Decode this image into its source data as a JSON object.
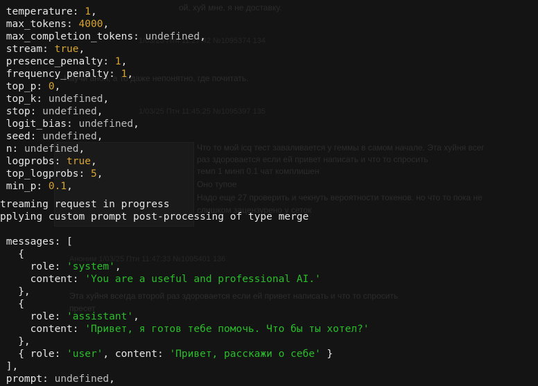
{
  "background_page": {
    "fragments": [
      "ой, хуй мне, я не доставку.",
      "Научи анон, а то даже непонятно, где почитать.",
      "Что то мой icq тест заваливается у геммы в самом начале. Эта хуйня всег",
      "раз здоровается если ей привет написать и что то спросить",
      "темп 1 минп 0.1 чат комплишен",
      "Оно тупое",
      "Надо еще 27 проверить и чекнуть вероятности токенов. но что то пока не",
      "слишком зацензурено у сеток",
      "Эта хуйня всегда второй раз здоровается если ей привет написать и что то спросить",
      "пресет"
    ],
    "meta_lines": [
      "1/03/25 Птн 11:27:42 №1095374 134",
      "1/03/25 Птн 11:45:25 №1095397 135",
      "Аноним 1/03/25 Птн 11:47:33 №1095401 136"
    ]
  },
  "terminal": {
    "params": [
      {
        "key": "temperature",
        "value": "1",
        "type": "num"
      },
      {
        "key": "max_tokens",
        "value": "4000",
        "type": "num"
      },
      {
        "key": "max_completion_tokens",
        "value": "undefined",
        "type": "undef"
      },
      {
        "key": "stream",
        "value": "true",
        "type": "bool"
      },
      {
        "key": "presence_penalty",
        "value": "1",
        "type": "num"
      },
      {
        "key": "frequency_penalty",
        "value": "1",
        "type": "num"
      },
      {
        "key": "top_p",
        "value": "0",
        "type": "num"
      },
      {
        "key": "top_k",
        "value": "undefined",
        "type": "undef"
      },
      {
        "key": "stop",
        "value": "undefined",
        "type": "undef"
      },
      {
        "key": "logit_bias",
        "value": "undefined",
        "type": "undef"
      },
      {
        "key": "seed",
        "value": "undefined",
        "type": "undef"
      },
      {
        "key": "n",
        "value": "undefined",
        "type": "undef"
      },
      {
        "key": "logprobs",
        "value": "true",
        "type": "bool"
      },
      {
        "key": "top_logprobs",
        "value": "5",
        "type": "num"
      },
      {
        "key": "min_p",
        "value": "0.1",
        "type": "num"
      }
    ],
    "status_1": "treaming request in progress",
    "status_2": "pplying custom prompt post-processing of type merge",
    "messages_key": "messages",
    "messages": [
      {
        "role": "'system'",
        "content": "'You are a useful and professional AI.'"
      },
      {
        "role": "'assistant'",
        "content": "'Привет, я готов тебе помочь. Что бы ты хотел?'"
      },
      {
        "role": "'user'",
        "content": "'Привет, расскажи о себе'"
      }
    ],
    "prompt_key": "prompt",
    "prompt_value": "undefined"
  }
}
